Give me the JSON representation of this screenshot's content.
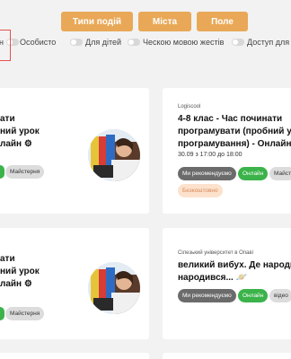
{
  "filters": {
    "event_types": "Типи подій",
    "city": "Міста",
    "field": "Поле"
  },
  "toggles": [
    {
      "label": "н"
    },
    {
      "label": "Особисто"
    },
    {
      "label": "Для дітей"
    },
    {
      "label": "Ческою мовою жестів"
    },
    {
      "label": "Доступ для і"
    }
  ],
  "cards": {
    "left1": {
      "title_lines": [
        "ати",
        "ний урок",
        "лайн ⚙"
      ],
      "tag_master": "Майстерня"
    },
    "right1": {
      "org": "Logiscool",
      "title_lines": [
        "4-8 клас - Час починати",
        "програмувати (пробний урок",
        "програмування) - Онлайн ⚙"
      ],
      "date": "30.09 з 17:00 до 18:00",
      "tag_recommend": "Ми рекомендуємо",
      "tag_online": "Онлайн",
      "tag_master": "Майст",
      "tag_free": "Безкоштовно"
    },
    "left2": {
      "title_lines": [
        "ати",
        "ний урок",
        "лайн ⚙"
      ],
      "tag_master": "Майстерня"
    },
    "right2": {
      "org": "Сілезький університет в Опаві",
      "title_lines": [
        "великий вибух. Де народив",
        "народився... 🪐"
      ],
      "tag_recommend": "Ми рекомендуємо",
      "tag_online": "Онлайн",
      "tag_video": "відео"
    }
  },
  "colors": {
    "accent": "#e9a857",
    "online": "#3bb34a",
    "focus": "#e8504f"
  }
}
